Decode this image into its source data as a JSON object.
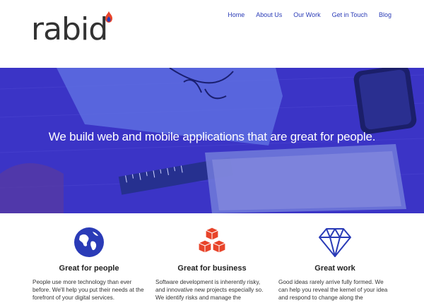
{
  "brand": {
    "name": "rabid",
    "flame_color": "#e8442a",
    "flame_inner": "#2a3bb7"
  },
  "nav": {
    "items": [
      {
        "label": "Home"
      },
      {
        "label": "About Us"
      },
      {
        "label": "Our Work"
      },
      {
        "label": "Get in Touch"
      },
      {
        "label": "Blog"
      }
    ],
    "color": "#2a3bb7"
  },
  "hero": {
    "headline": "We build web and mobile applications that are great for people.",
    "overlay_color": "#3b34c6"
  },
  "features": [
    {
      "icon": "globe-icon",
      "icon_color": "#2a3bb7",
      "title": "Great for people",
      "body": "People use more technology than ever before. We'll help you put their needs at the forefront of your digital services."
    },
    {
      "icon": "boxes-icon",
      "icon_color": "#e8442a",
      "title": "Great for business",
      "body": "Software development is inherently risky, and innovative new projects especially so. We identify risks and manage the"
    },
    {
      "icon": "diamond-icon",
      "icon_color": "#2a3bb7",
      "title": "Great work",
      "body": "Good ideas rarely arrive fully formed. We can help you reveal the kernel of your idea and respond to change along the"
    }
  ]
}
